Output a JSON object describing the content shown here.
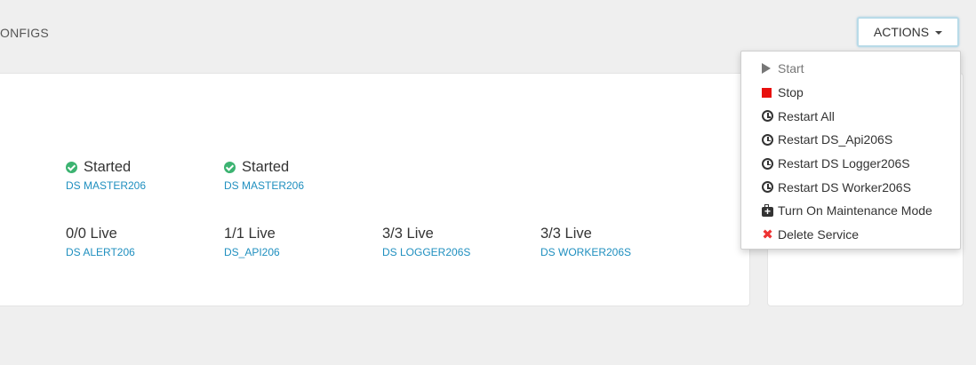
{
  "tabs": {
    "configs_label": "ONFIGS"
  },
  "actions": {
    "label": "ACTIONS",
    "menu": [
      {
        "label": "Start",
        "icon": "play-icon",
        "disabled": true
      },
      {
        "label": "Stop",
        "icon": "stop-icon"
      },
      {
        "label": "Restart All",
        "icon": "clock-icon"
      },
      {
        "label": "Restart DS_Api206S",
        "icon": "clock-icon"
      },
      {
        "label": "Restart DS Logger206S",
        "icon": "clock-icon"
      },
      {
        "label": "Restart DS Worker206S",
        "icon": "clock-icon"
      },
      {
        "label": "Turn On Maintenance Mode",
        "icon": "medkit-icon"
      },
      {
        "label": "Delete Service",
        "icon": "delete-icon"
      }
    ]
  },
  "components": {
    "masters": [
      {
        "status": "Started",
        "name": "DS MASTER206"
      },
      {
        "status": "Started",
        "name": "DS MASTER206"
      }
    ],
    "slaves": [
      {
        "status": "0/0 Live",
        "name": "DS ALERT206"
      },
      {
        "status": "1/1 Live",
        "name": "DS_API206"
      },
      {
        "status": "3/3 Live",
        "name": "DS LOGGER206S"
      },
      {
        "status": "3/3 Live",
        "name": "DS WORKER206S"
      }
    ]
  },
  "colors": {
    "link": "#1f8fbf",
    "started_check": "#3cb371",
    "stop_icon": "#e8100e",
    "delete_icon": "#e33"
  }
}
